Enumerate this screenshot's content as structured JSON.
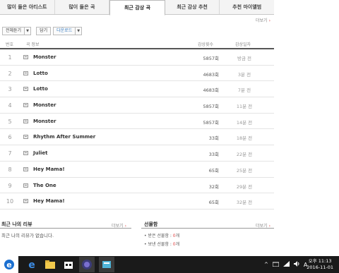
{
  "tabs": [
    {
      "label": "많이 들은 아티스트",
      "active": false
    },
    {
      "label": "많이 들은 곡",
      "active": false
    },
    {
      "label": "최근 감상 곡",
      "active": true
    },
    {
      "label": "최근 감상 추천",
      "active": false
    },
    {
      "label": "추천 마이앨범",
      "active": false
    }
  ],
  "more_label": "더보기",
  "toolbar": {
    "select_all": "전체듣기",
    "add": "담기",
    "download": "다운로드"
  },
  "table": {
    "headers": {
      "num": "번호",
      "info": "곡 정보",
      "count": "감상횟수",
      "date": "감상일자"
    },
    "rows": [
      {
        "num": "1",
        "title": "Monster",
        "count": "5857회",
        "date": "방금 전"
      },
      {
        "num": "2",
        "title": "Lotto",
        "count": "4683회",
        "date": "3분 전"
      },
      {
        "num": "3",
        "title": "Lotto",
        "count": "4683회",
        "date": "7분 전"
      },
      {
        "num": "4",
        "title": "Monster",
        "count": "5857회",
        "date": "11분 전"
      },
      {
        "num": "5",
        "title": "Monster",
        "count": "5857회",
        "date": "14분 전"
      },
      {
        "num": "6",
        "title": "Rhythm After Summer",
        "count": "33회",
        "date": "18분 전"
      },
      {
        "num": "7",
        "title": "Juliet",
        "count": "33회",
        "date": "22분 전"
      },
      {
        "num": "8",
        "title": "Hey Mama!",
        "count": "65회",
        "date": "25분 전"
      },
      {
        "num": "9",
        "title": "The One",
        "count": "32회",
        "date": "29분 전"
      },
      {
        "num": "10",
        "title": "Hey Mama!",
        "count": "65회",
        "date": "32분 전"
      }
    ]
  },
  "review": {
    "title": "최근 나의 리뷰",
    "more": "더보기",
    "empty": "최근 나의 리뷰가 없습니다."
  },
  "gift": {
    "title": "선물함",
    "more": "더보기",
    "received_label": "받은 선물함 : ",
    "received_count": "0",
    "received_unit": "개",
    "sent_label": "보낸 선물함 : ",
    "sent_count": "0",
    "sent_unit": "개"
  },
  "taskbar": {
    "ime": "A",
    "time": "오후 11:13",
    "date": "2016-11-01"
  }
}
